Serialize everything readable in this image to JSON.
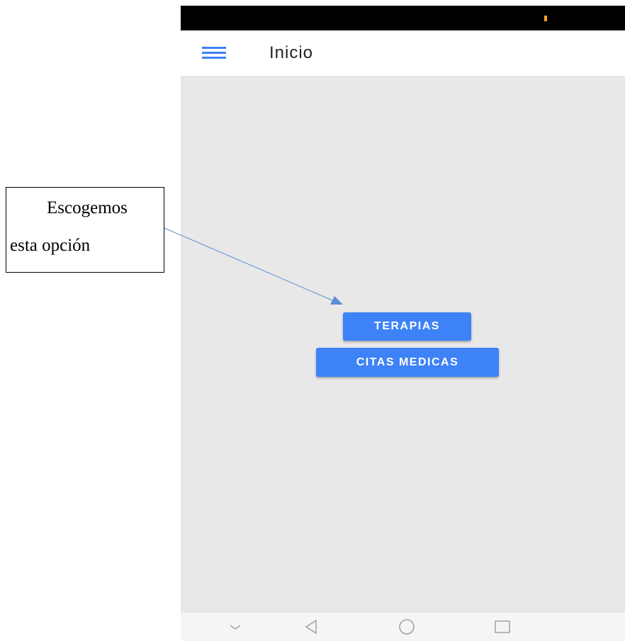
{
  "colors": {
    "accent": "#3d82f7",
    "status_indicator": "#f5a623",
    "annotation_arrow": "#5b8fd6"
  },
  "app_bar": {
    "menu_icon": "hamburger-menu-icon",
    "title": "Inicio"
  },
  "main": {
    "buttons": [
      {
        "label": "TERAPIAS"
      },
      {
        "label": "CITAS MEDICAS"
      }
    ]
  },
  "nav_bar": {
    "items": [
      "chevron-down-icon",
      "back-triangle-icon",
      "home-circle-icon",
      "recents-square-icon"
    ]
  },
  "annotation": {
    "line1": "Escogemos",
    "line2": "esta opción"
  }
}
